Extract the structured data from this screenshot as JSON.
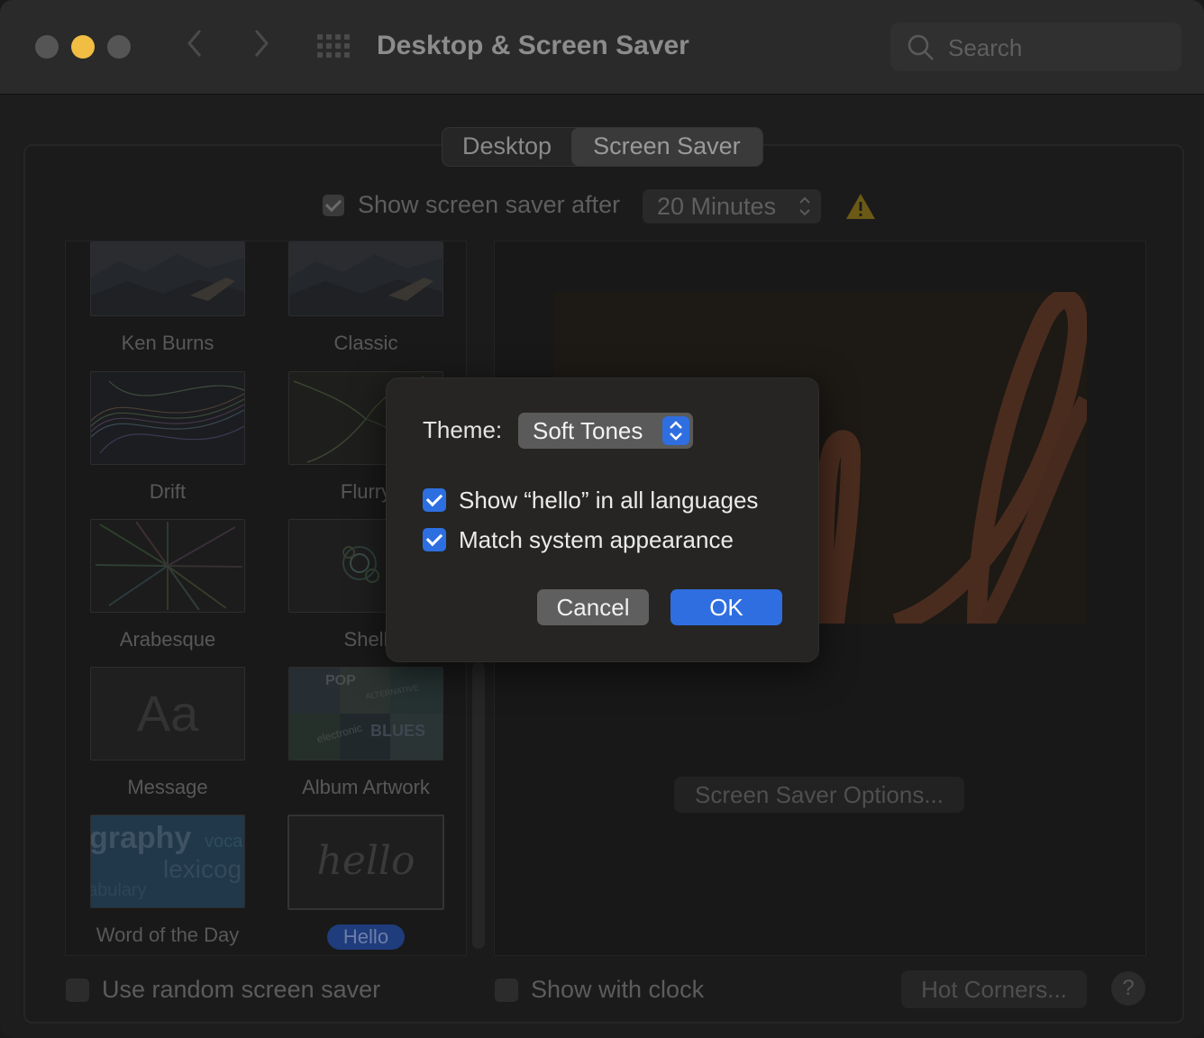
{
  "window": {
    "title": "Desktop & Screen Saver",
    "search_placeholder": "Search"
  },
  "tabs": [
    {
      "label": "Desktop",
      "active": false
    },
    {
      "label": "Screen Saver",
      "active": true
    }
  ],
  "show_after": {
    "label": "Show screen saver after",
    "checked": true,
    "selected": "20 Minutes"
  },
  "savers": [
    {
      "label": "Ken Burns"
    },
    {
      "label": "Classic"
    },
    {
      "label": "Drift"
    },
    {
      "label": "Flurry"
    },
    {
      "label": "Arabesque"
    },
    {
      "label": "Shell"
    },
    {
      "label": "Message",
      "thumb_text": "Aa"
    },
    {
      "label": "Album Artwork",
      "thumb_words": [
        "POP",
        "ALTERNATIVE",
        "electronic",
        "BLUES"
      ]
    },
    {
      "label": "Word of the Day",
      "thumb_words": [
        "graphy",
        "voca",
        "lexicog",
        "abulary"
      ]
    },
    {
      "label": "Hello",
      "selected": true,
      "thumb_text": "hello"
    }
  ],
  "preview": {
    "options_button": "Screen Saver Options..."
  },
  "bottom": {
    "random_label": "Use random screen saver",
    "clock_label": "Show with clock",
    "hot_corners": "Hot Corners...",
    "help": "?"
  },
  "dialog": {
    "theme_label": "Theme:",
    "theme_value": "Soft Tones",
    "option1": "Show “hello” in all languages",
    "option2": "Match system appearance",
    "cancel": "Cancel",
    "ok": "OK"
  },
  "colors": {
    "accent": "#2f6ee0",
    "minimize": "#f2bd43"
  }
}
